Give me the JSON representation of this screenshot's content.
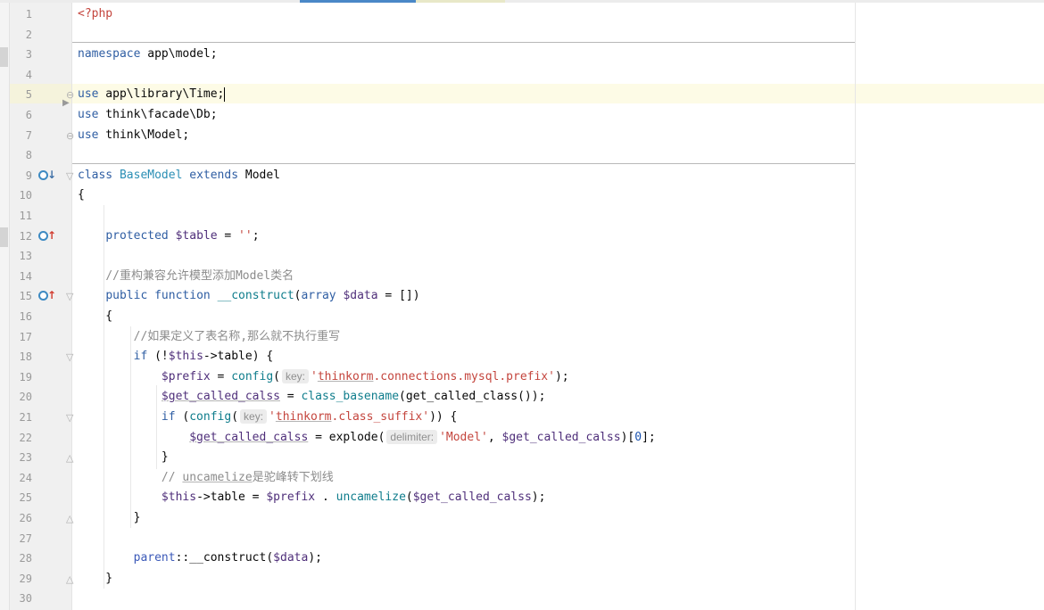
{
  "editor": {
    "language": "php",
    "current_line": 5,
    "lines": [
      {
        "n": "1",
        "tokens": [
          {
            "t": "<?php",
            "c": "php"
          }
        ]
      },
      {
        "n": "2",
        "tokens": []
      },
      {
        "n": "3",
        "tokens": [
          {
            "t": "namespace",
            "c": "kw"
          },
          {
            "t": " app\\model;",
            "c": ""
          }
        ]
      },
      {
        "n": "4",
        "tokens": []
      },
      {
        "n": "5",
        "tokens": [
          {
            "t": "use",
            "c": "kw"
          },
          {
            "t": " app\\library\\Time;",
            "c": ""
          }
        ],
        "caret": true
      },
      {
        "n": "6",
        "tokens": [
          {
            "t": "use",
            "c": "kw"
          },
          {
            "t": " think\\facade\\Db;",
            "c": ""
          }
        ]
      },
      {
        "n": "7",
        "tokens": [
          {
            "t": "use",
            "c": "kw"
          },
          {
            "t": " think\\Model;",
            "c": ""
          }
        ]
      },
      {
        "n": "8",
        "tokens": []
      },
      {
        "n": "9",
        "tokens": [
          {
            "t": "class ",
            "c": "kw"
          },
          {
            "t": "BaseModel",
            "c": "cls"
          },
          {
            "t": " extends ",
            "c": "kw"
          },
          {
            "t": "Model",
            "c": ""
          }
        ]
      },
      {
        "n": "10",
        "tokens": [
          {
            "t": "{",
            "c": ""
          }
        ]
      },
      {
        "n": "11",
        "tokens": []
      },
      {
        "n": "12",
        "tokens": [
          {
            "t": "    "
          },
          {
            "t": "protected ",
            "c": "kw"
          },
          {
            "t": "$table",
            "c": "var"
          },
          {
            "t": " = ",
            "c": ""
          },
          {
            "t": "''",
            "c": "str"
          },
          {
            "t": ";",
            "c": ""
          }
        ]
      },
      {
        "n": "13",
        "tokens": []
      },
      {
        "n": "14",
        "tokens": [
          {
            "t": "    "
          },
          {
            "t": "//重构兼容允许模型添加Model类名",
            "c": "com"
          }
        ]
      },
      {
        "n": "15",
        "tokens": [
          {
            "t": "    "
          },
          {
            "t": "public ",
            "c": "kw"
          },
          {
            "t": "function ",
            "c": "kw"
          },
          {
            "t": "__construct",
            "c": "fn"
          },
          {
            "t": "(",
            "c": ""
          },
          {
            "t": "array ",
            "c": "kw"
          },
          {
            "t": "$data",
            "c": "var"
          },
          {
            "t": " = [])",
            "c": ""
          }
        ]
      },
      {
        "n": "16",
        "tokens": [
          {
            "t": "    {",
            "c": ""
          }
        ]
      },
      {
        "n": "17",
        "tokens": [
          {
            "t": "        "
          },
          {
            "t": "//如果定义了表名称,那么就不执行重写",
            "c": "com"
          }
        ]
      },
      {
        "n": "18",
        "tokens": [
          {
            "t": "        "
          },
          {
            "t": "if ",
            "c": "kw"
          },
          {
            "t": "(!",
            "c": ""
          },
          {
            "t": "$this",
            "c": "var"
          },
          {
            "t": "->table) {",
            "c": ""
          }
        ]
      },
      {
        "n": "19",
        "tokens": [
          {
            "t": "            "
          },
          {
            "t": "$prefix",
            "c": "var"
          },
          {
            "t": " = ",
            "c": ""
          },
          {
            "t": "config",
            "c": "fn"
          },
          {
            "t": "(",
            "c": ""
          },
          {
            "hint": "key:"
          },
          {
            "t": "'",
            "c": "str"
          },
          {
            "t": "thinkorm",
            "c": "str uline"
          },
          {
            "t": ".connections.mysql.prefix'",
            "c": "str"
          },
          {
            "t": ");",
            "c": ""
          }
        ]
      },
      {
        "n": "20",
        "tokens": [
          {
            "t": "            "
          },
          {
            "t": "$get_called_calss",
            "c": "var uline"
          },
          {
            "t": " = ",
            "c": ""
          },
          {
            "t": "class_basename",
            "c": "fn"
          },
          {
            "t": "(get_called_class());",
            "c": ""
          }
        ]
      },
      {
        "n": "21",
        "tokens": [
          {
            "t": "            "
          },
          {
            "t": "if ",
            "c": "kw"
          },
          {
            "t": "(",
            "c": ""
          },
          {
            "t": "config",
            "c": "fn"
          },
          {
            "t": "(",
            "c": ""
          },
          {
            "hint": "key:"
          },
          {
            "t": "'",
            "c": "str"
          },
          {
            "t": "thinkorm",
            "c": "str uline"
          },
          {
            "t": ".class_suffix'",
            "c": "str"
          },
          {
            "t": ")) {",
            "c": ""
          }
        ]
      },
      {
        "n": "22",
        "tokens": [
          {
            "t": "                "
          },
          {
            "t": "$get_called_calss",
            "c": "var uline"
          },
          {
            "t": " = explode(",
            "c": ""
          },
          {
            "hint": "delimiter:"
          },
          {
            "t": "'Model'",
            "c": "str"
          },
          {
            "t": ", ",
            "c": ""
          },
          {
            "t": "$get_called_calss",
            "c": "var"
          },
          {
            "t": ")[",
            "c": ""
          },
          {
            "t": "0",
            "c": "num"
          },
          {
            "t": "];",
            "c": ""
          }
        ]
      },
      {
        "n": "23",
        "tokens": [
          {
            "t": "            }",
            "c": ""
          }
        ]
      },
      {
        "n": "24",
        "tokens": [
          {
            "t": "            "
          },
          {
            "t": "// ",
            "c": "com"
          },
          {
            "t": "uncamelize",
            "c": "com uline"
          },
          {
            "t": "是驼峰转下划线",
            "c": "com"
          }
        ]
      },
      {
        "n": "25",
        "tokens": [
          {
            "t": "            "
          },
          {
            "t": "$this",
            "c": "var"
          },
          {
            "t": "->table = ",
            "c": ""
          },
          {
            "t": "$prefix",
            "c": "var"
          },
          {
            "t": " . ",
            "c": ""
          },
          {
            "t": "uncamelize",
            "c": "fn"
          },
          {
            "t": "(",
            "c": ""
          },
          {
            "t": "$get_called_calss",
            "c": "var"
          },
          {
            "t": ");",
            "c": ""
          }
        ]
      },
      {
        "n": "26",
        "tokens": [
          {
            "t": "        }",
            "c": ""
          }
        ]
      },
      {
        "n": "27",
        "tokens": []
      },
      {
        "n": "28",
        "tokens": [
          {
            "t": "        "
          },
          {
            "t": "parent",
            "c": "kw2"
          },
          {
            "t": "::__construct(",
            "c": ""
          },
          {
            "t": "$data",
            "c": "var"
          },
          {
            "t": ");",
            "c": ""
          }
        ]
      },
      {
        "n": "29",
        "tokens": [
          {
            "t": "    }",
            "c": ""
          }
        ]
      },
      {
        "n": "30",
        "tokens": []
      }
    ]
  },
  "gutter_markers": [
    {
      "line": 9,
      "icon": "override-down-icon",
      "color": "#3d8ac2",
      "arrow": "↓",
      "arrow_color": "#3d6fa6"
    },
    {
      "line": 12,
      "icon": "implements-up-icon",
      "color": "#3d8ac2",
      "arrow": "↑",
      "arrow_color": "#d23b2f"
    },
    {
      "line": 15,
      "icon": "implements-up-icon",
      "color": "#3d8ac2",
      "arrow": "↑",
      "arrow_color": "#d23b2f"
    }
  ],
  "folds": [
    {
      "line": 5,
      "glyph": "⊖"
    },
    {
      "line": 7,
      "glyph": "⊖"
    },
    {
      "line": 9,
      "glyph": "▽"
    },
    {
      "line": 15,
      "glyph": "▽"
    },
    {
      "line": 18,
      "glyph": "▽"
    },
    {
      "line": 21,
      "glyph": "▽"
    },
    {
      "line": 23,
      "glyph": "△"
    },
    {
      "line": 26,
      "glyph": "△"
    },
    {
      "line": 29,
      "glyph": "△"
    }
  ]
}
